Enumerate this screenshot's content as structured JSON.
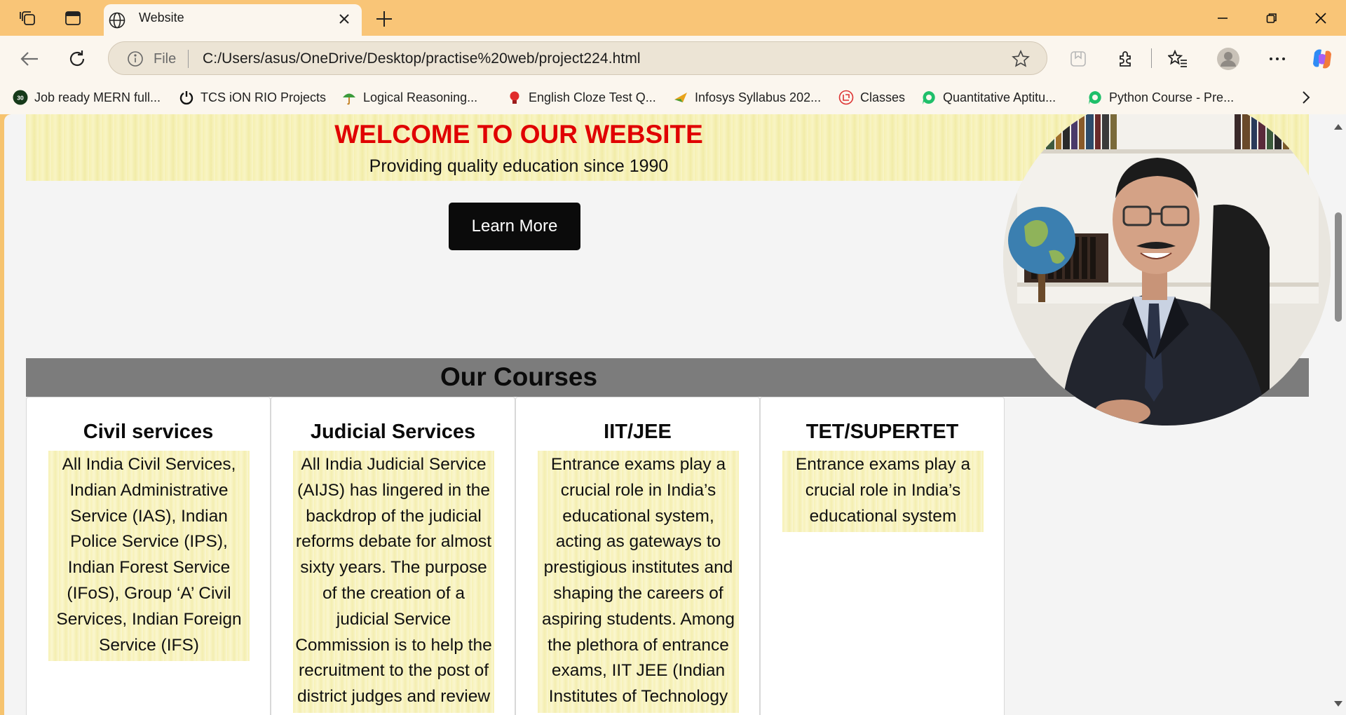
{
  "browser": {
    "tab": {
      "title": "Website"
    },
    "address": {
      "scheme_label": "File",
      "url": "C:/Users/asus/OneDrive/Desktop/practise%20web/project224.html"
    },
    "bookmarks": [
      {
        "label": "Job ready MERN full...",
        "icon": "30-badge-icon"
      },
      {
        "label": "TCS iON RIO Projects",
        "icon": "power-icon"
      },
      {
        "label": "Logical Reasoning...",
        "icon": "umbrella-icon"
      },
      {
        "label": "English Cloze Test Q...",
        "icon": "bulb-icon"
      },
      {
        "label": "Infosys Syllabus 202...",
        "icon": "plane-icon"
      },
      {
        "label": "Classes",
        "icon": "classes-icon"
      },
      {
        "label": "Quantitative Aptitu...",
        "icon": "quant-icon"
      },
      {
        "label": "Python Course - Pre...",
        "icon": "python-course-icon"
      }
    ]
  },
  "page": {
    "hero": {
      "title": "WELCOME TO OUR WEBSITE",
      "subtitle": "Providing quality education since 1990",
      "button_label": "Learn More"
    },
    "courses": {
      "heading": "Our Courses",
      "items": [
        {
          "title": "Civil services",
          "description": "All India Civil Services, Indian Administrative Service (IAS), Indian Police Service (IPS), Indian Forest Service (IFoS), Group ‘A’ Civil Services, Indian Foreign Service (IFS)"
        },
        {
          "title": "Judicial Services",
          "description": "All India Judicial Service (AIJS) has lingered in the backdrop of the judicial reforms debate for almost sixty years. The purpose of the creation of a judicial Service Commission is to help the recruitment to the post of district judges and review"
        },
        {
          "title": "IIT/JEE",
          "description": "Entrance exams play a crucial role in India’s educational system, acting as gateways to prestigious institutes and shaping the careers of aspiring students. Among the plethora of entrance exams, IIT JEE (Indian Institutes of Technology"
        },
        {
          "title": "TET/SUPERTET",
          "description": "Entrance exams play a crucial role in India’s educational system"
        }
      ]
    }
  },
  "colors": {
    "tabbar": "#f9c577",
    "hero_title": "#e00000",
    "banner": "#f6f0b0",
    "courses_bar": "#7c7c7c"
  }
}
